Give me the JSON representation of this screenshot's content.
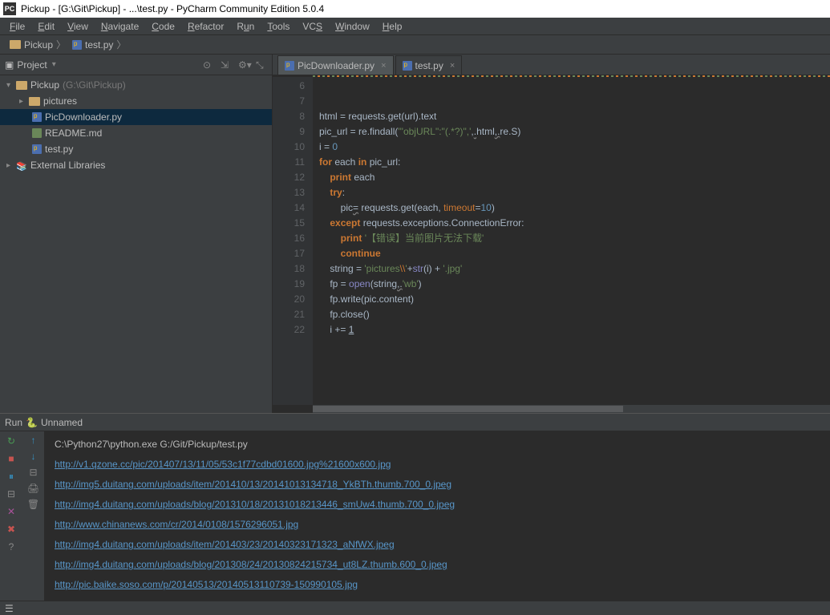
{
  "title": "Pickup - [G:\\Git\\Pickup] - ...\\test.py - PyCharm Community Edition 5.0.4",
  "menu": [
    "File",
    "Edit",
    "View",
    "Navigate",
    "Code",
    "Refactor",
    "Run",
    "Tools",
    "VCS",
    "Window",
    "Help"
  ],
  "breadcrumbs": {
    "root": "Pickup",
    "file": "test.py"
  },
  "project": {
    "header": "Project",
    "root": {
      "name": "Pickup",
      "path": "(G:\\Git\\Pickup)"
    },
    "items": [
      {
        "name": "pictures",
        "type": "folder"
      },
      {
        "name": "PicDownloader.py",
        "type": "py",
        "selected": true
      },
      {
        "name": "README.md",
        "type": "md"
      },
      {
        "name": "test.py",
        "type": "py"
      }
    ],
    "external": "External Libraries"
  },
  "tabs": [
    {
      "name": "PicDownloader.py",
      "active": false
    },
    {
      "name": "test.py",
      "active": true
    }
  ],
  "gutter_start": 6,
  "gutter_end": 22,
  "run": {
    "label": "Run",
    "config": "Unnamed",
    "command": "C:\\Python27\\python.exe G:/Git/Pickup/test.py",
    "output": [
      "http://v1.qzone.cc/pic/201407/13/11/05/53c1f77cdbd01600.jpg%21600x600.jpg",
      "http://img5.duitang.com/uploads/item/201410/13/20141013134718_YkBTh.thumb.700_0.jpeg",
      "http://img4.duitang.com/uploads/blog/201310/18/20131018213446_smUw4.thumb.700_0.jpeg",
      "http://www.chinanews.com/cr/2014/0108/1576296051.jpg",
      "http://img4.duitang.com/uploads/item/201403/23/20140323171323_aNfWX.jpeg",
      "http://img4.duitang.com/uploads/blog/201308/24/20130824215734_ut8LZ.thumb.600_0.jpeg",
      "http://pic.baike.soso.com/p/20140513/20140513110739-150990105.jpg"
    ]
  }
}
